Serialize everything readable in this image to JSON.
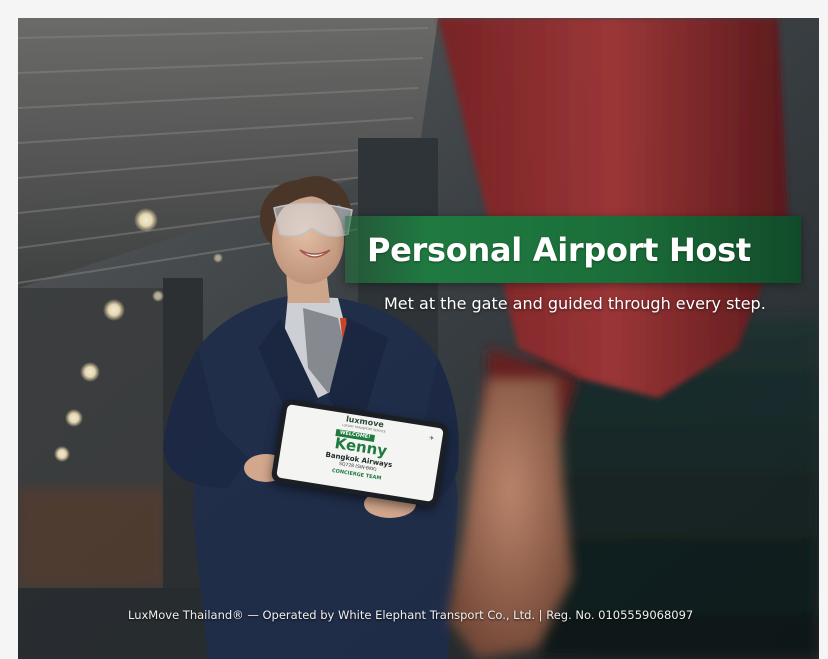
{
  "banner": {
    "title": "Personal Airport Host",
    "subtitle": "Met at the gate and guided through every step."
  },
  "footer": {
    "text": "LuxMove Thailand® — Operated by White Elephant Transport Co., Ltd. | Reg. No. 0105559068097"
  },
  "tablet": {
    "logo": "luxmove",
    "logo_sub": "LUXURY TRANSPORT SERVICE",
    "welcome": "WELCOME!",
    "name": "Kenny",
    "airline": "Bangkok Airways",
    "flight": "SQ728 (SIN-BKK)",
    "team": "CONCIERGE TEAM",
    "plane_icon": "airplane-icon"
  },
  "colors": {
    "banner_green": "#1f7a40",
    "banner_dark_green": "#114b2a",
    "text_white": "#ffffff",
    "jacket_navy": "#1e2c4a",
    "sleeve_red": "#8e2a2a"
  }
}
